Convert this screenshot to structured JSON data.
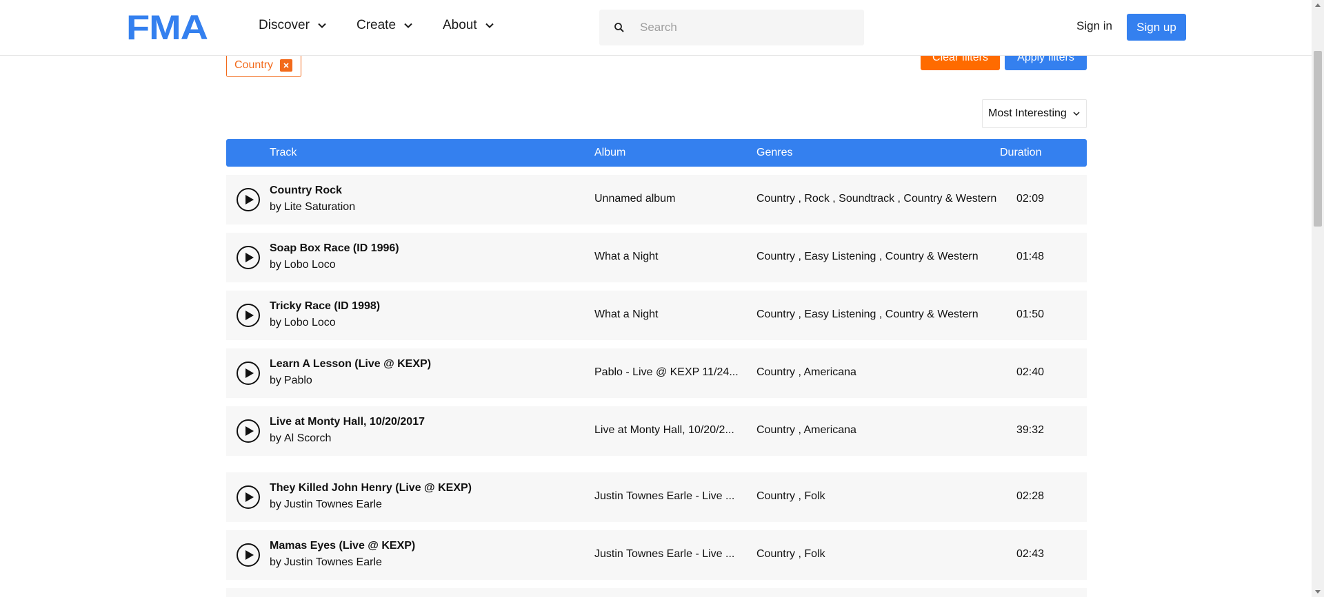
{
  "header": {
    "logo": "FMA",
    "nav": [
      "Discover",
      "Create",
      "About"
    ],
    "search_placeholder": "Search",
    "signin": "Sign in",
    "signup": "Sign up"
  },
  "filters": {
    "active_tag": "Country",
    "clear_label": "Clear filters",
    "apply_label": "Apply filters"
  },
  "sort": {
    "selected": "Most Interesting"
  },
  "table": {
    "columns": [
      "Track",
      "Album",
      "Genres",
      "Duration"
    ],
    "rows": [
      {
        "title": "Country Rock",
        "by": "by",
        "artist": "Lite Saturation",
        "album": "Unnamed album",
        "genres": "Country , Rock , Soundtrack , Country & Western",
        "duration": "02:09"
      },
      {
        "title": "Soap Box Race (ID 1996)",
        "by": "by",
        "artist": "Lobo Loco",
        "album": "What a Night",
        "genres": "Country , Easy Listening , Country & Western",
        "duration": "01:48"
      },
      {
        "title": "Tricky Race (ID 1998)",
        "by": "by",
        "artist": "Lobo Loco",
        "album": "What a Night",
        "genres": "Country , Easy Listening , Country & Western",
        "duration": "01:50"
      },
      {
        "title": "Learn A Lesson (Live @ KEXP)",
        "by": "by",
        "artist": "Pablo",
        "album": "Pablo - Live @ KEXP 11/24...",
        "genres": "Country , Americana",
        "duration": "02:40"
      },
      {
        "title": "Live at Monty Hall, 10/20/2017",
        "by": "by",
        "artist": "Al Scorch",
        "album": "Live at Monty Hall, 10/20/2...",
        "genres": "Country , Americana",
        "duration": "39:32"
      },
      {
        "title": "They Killed John Henry (Live @ KEXP)",
        "by": "by",
        "artist": "Justin Townes Earle",
        "album": "Justin Townes Earle - Live ...",
        "genres": "Country , Folk",
        "duration": "02:28"
      },
      {
        "title": "Mamas Eyes (Live @ KEXP)",
        "by": "by",
        "artist": "Justin Townes Earle",
        "album": "Justin Townes Earle - Live ...",
        "genres": "Country , Folk",
        "duration": "02:43"
      }
    ]
  },
  "colors": {
    "brand_blue": "#3480ef",
    "filter_orange": "#ff6b00",
    "row_bg": "#f7f7f7"
  }
}
